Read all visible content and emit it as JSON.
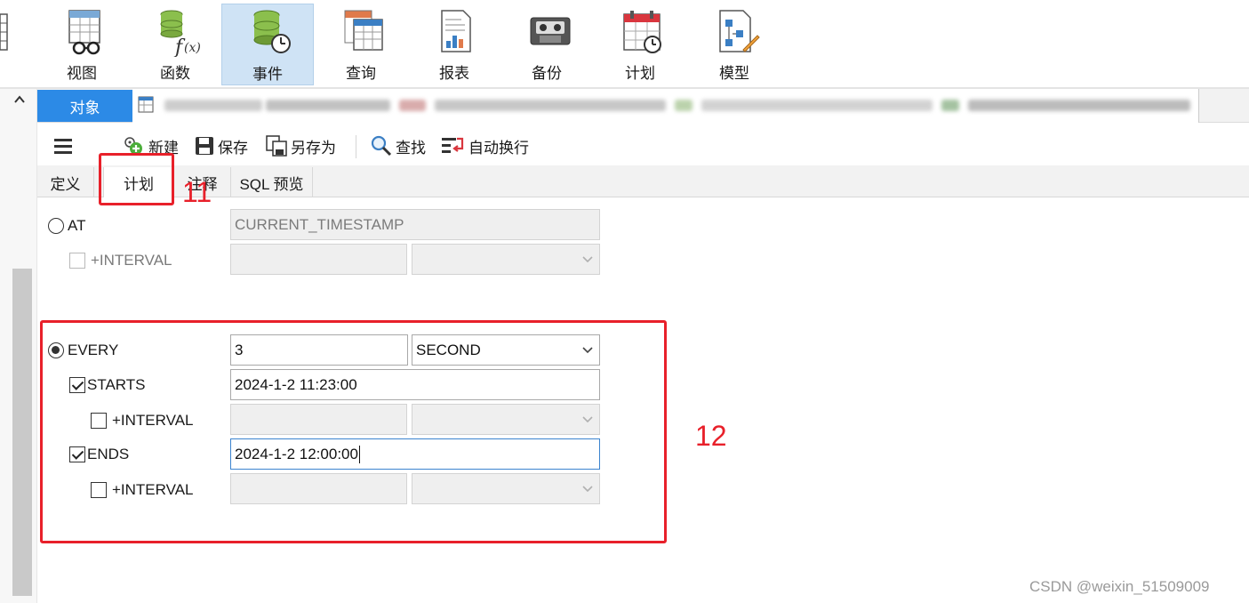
{
  "ribbon": {
    "items": [
      {
        "label": "视图",
        "icon": "view-icon"
      },
      {
        "label": "函数",
        "icon": "function-icon"
      },
      {
        "label": "事件",
        "icon": "event-icon",
        "active": true
      },
      {
        "label": "查询",
        "icon": "query-icon"
      },
      {
        "label": "报表",
        "icon": "report-icon"
      },
      {
        "label": "备份",
        "icon": "backup-icon"
      },
      {
        "label": "计划",
        "icon": "schedule-icon"
      },
      {
        "label": "模型",
        "icon": "model-icon"
      }
    ]
  },
  "object_tab": {
    "label": "对象"
  },
  "toolbar": {
    "menu_icon": "hamburger-icon",
    "new_label": "新建",
    "save_label": "保存",
    "save_as_label": "另存为",
    "find_label": "查找",
    "wrap_label": "自动换行"
  },
  "subtabs": [
    {
      "label": "定义"
    },
    {
      "label": "计划",
      "active": true
    },
    {
      "label": "注释"
    },
    {
      "label": "SQL 预览"
    }
  ],
  "schedule": {
    "at": {
      "label": "AT",
      "selected": false,
      "value": "CURRENT_TIMESTAMP"
    },
    "at_interval": {
      "label": "+INTERVAL",
      "checked": false
    },
    "every": {
      "label": "EVERY",
      "selected": true,
      "value": "3",
      "unit": "SECOND"
    },
    "starts": {
      "label": "STARTS",
      "checked": true,
      "value": "2024-1-2 11:23:00"
    },
    "starts_interval": {
      "label": "+INTERVAL",
      "checked": false
    },
    "ends": {
      "label": "ENDS",
      "checked": true,
      "value": "2024-1-2 12:00:00"
    },
    "ends_interval": {
      "label": "+INTERVAL",
      "checked": false
    }
  },
  "annotations": {
    "box1": "11",
    "box2": "12"
  },
  "watermark": "CSDN @weixin_51509009",
  "colors": {
    "accent": "#2c8ae6",
    "annotation": "#e8202a",
    "active_ribbon": "#cfe3f5"
  }
}
